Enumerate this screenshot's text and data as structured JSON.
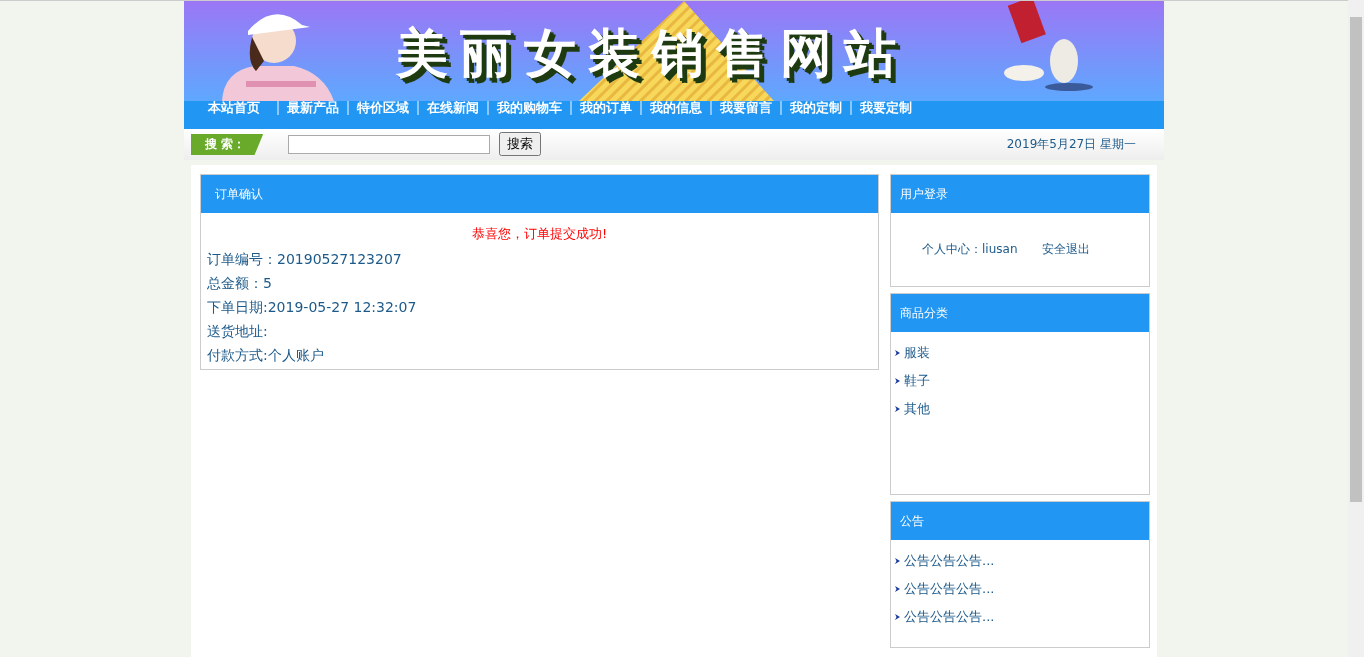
{
  "banner": {
    "title": "美丽女装销售网站"
  },
  "nav": [
    {
      "label": "本站首页"
    },
    {
      "label": "最新产品"
    },
    {
      "label": "特价区域"
    },
    {
      "label": "在线新闻"
    },
    {
      "label": "我的购物车"
    },
    {
      "label": "我的订单"
    },
    {
      "label": "我的信息"
    },
    {
      "label": "我要留言"
    },
    {
      "label": "我的定制"
    },
    {
      "label": "我要定制"
    }
  ],
  "search": {
    "label": "搜 索：",
    "button": "搜索",
    "date": "2019年5月27日 星期一"
  },
  "order": {
    "title": "订单确认",
    "message": "恭喜您，订单提交成功!",
    "fields": [
      "订单编号：20190527123207",
      "总金额：5",
      "下单日期:2019-05-27 12:32:07",
      "送货地址:",
      "付款方式:个人账户"
    ]
  },
  "login": {
    "title": "用户登录",
    "user": "个人中心：liusan",
    "logout": "安全退出"
  },
  "categories": {
    "title": "商品分类",
    "items": [
      "服装",
      "鞋子",
      "其他"
    ]
  },
  "notices": {
    "title": "公告",
    "items": [
      "公告公告公告...",
      "公告公告公告...",
      "公告公告公告..."
    ]
  }
}
